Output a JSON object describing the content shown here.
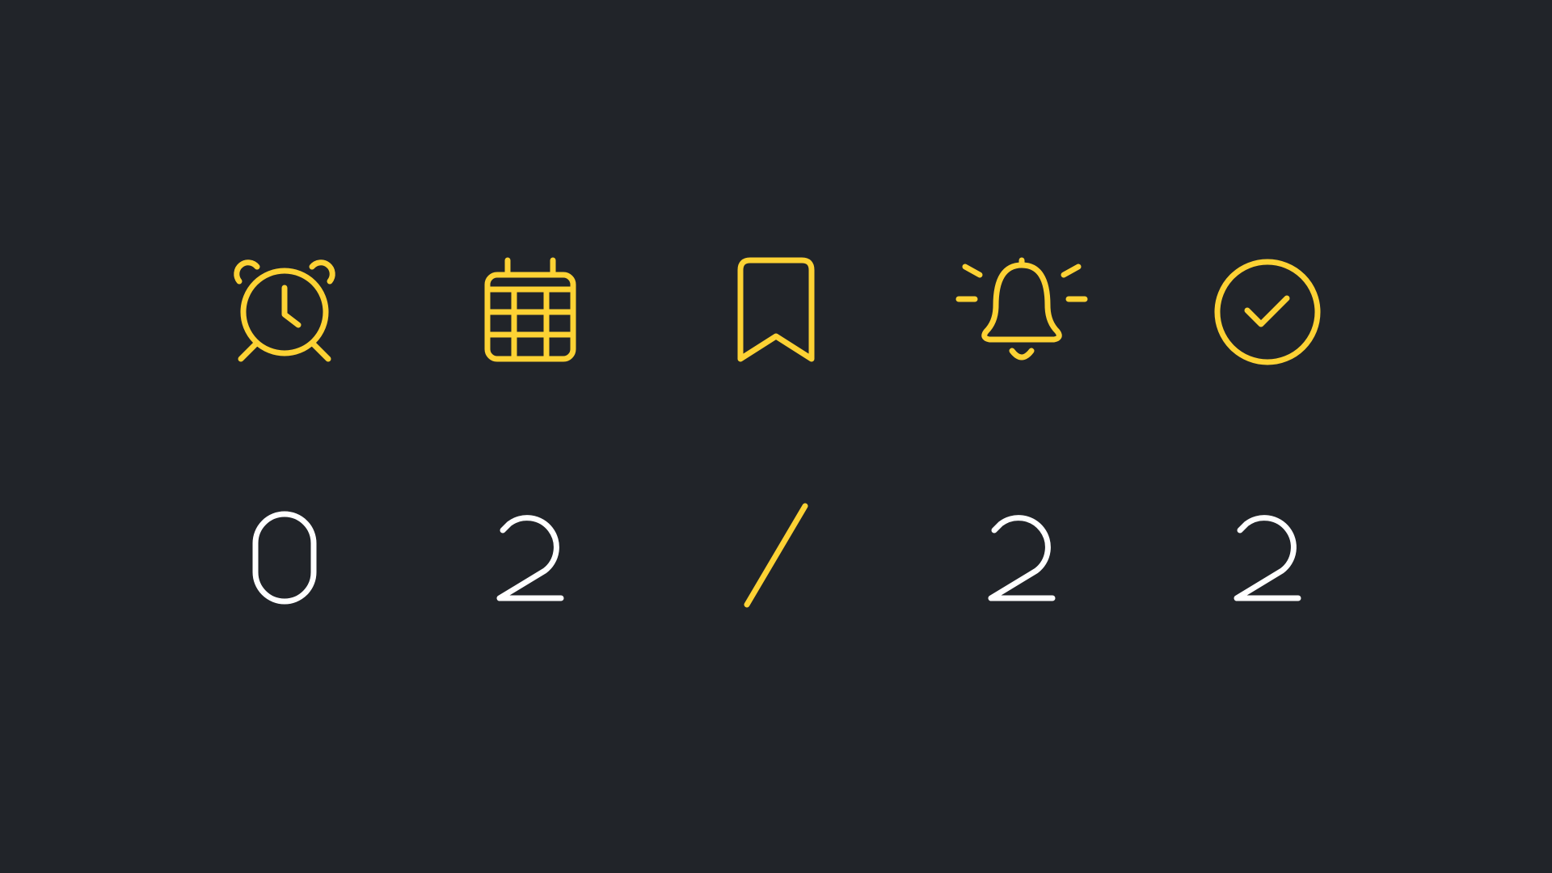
{
  "colors": {
    "background": "#212429",
    "accent": "#FDD234",
    "text": "#FFFFFF"
  },
  "icons": [
    {
      "name": "alarm-clock-icon"
    },
    {
      "name": "calendar-icon"
    },
    {
      "name": "bookmark-icon"
    },
    {
      "name": "bell-icon"
    },
    {
      "name": "check-circle-icon"
    }
  ],
  "date": {
    "chars": [
      "0",
      "2",
      "/",
      "2",
      "2"
    ]
  }
}
